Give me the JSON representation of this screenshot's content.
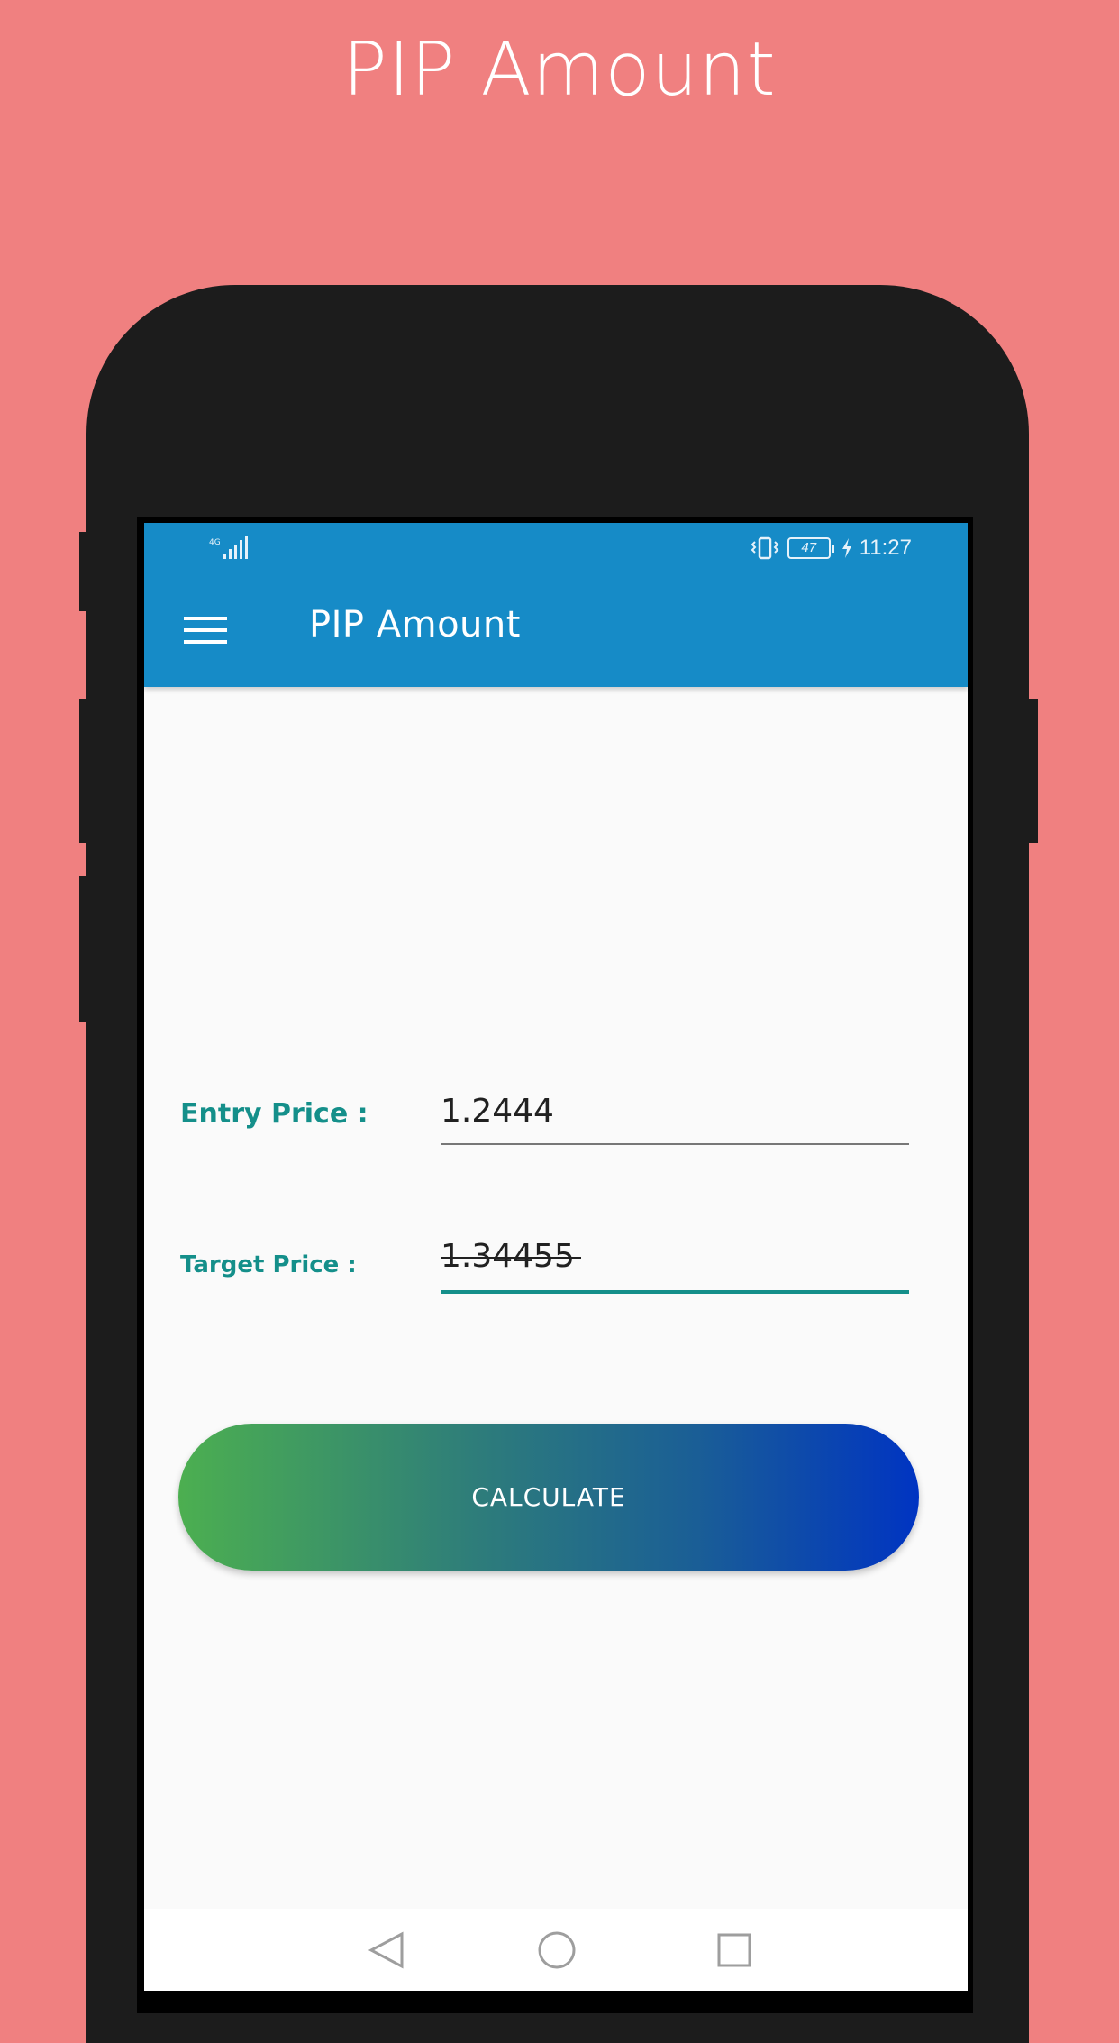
{
  "promo": {
    "title": "PIP Amount"
  },
  "status_bar": {
    "network": "4G",
    "battery": "47",
    "time": "11:27"
  },
  "app_bar": {
    "title": "PIP Amount",
    "menu_icon": "hamburger-menu-icon"
  },
  "form": {
    "entry_price": {
      "label": "Entry Price :",
      "value": "1.2444"
    },
    "target_price": {
      "label": "Target Price :",
      "value": "1.34455"
    }
  },
  "calculate_button": {
    "label": "CALCULATE"
  },
  "nav_bar": {
    "back_icon": "triangle-back-icon",
    "home_icon": "circle-home-icon",
    "recents_icon": "square-recents-icon"
  },
  "colors": {
    "background": "#F08080",
    "app_bar": "#168BC7",
    "label_teal": "#148F8A",
    "gradient_start": "#4CAF50",
    "gradient_end": "#0034C2"
  }
}
